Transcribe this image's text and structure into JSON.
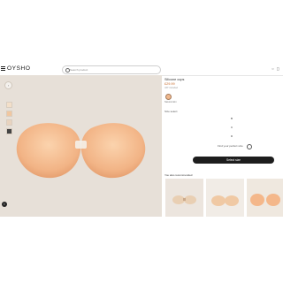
{
  "header": {
    "brand": "OYSHO",
    "search_placeholder": "Search product",
    "icons": [
      "user-icon",
      "heart-icon",
      "bag-icon"
    ]
  },
  "gallery": {
    "back_label": "‹",
    "info_label": "i"
  },
  "product": {
    "title": "Silicone cups",
    "price": "£29.99",
    "vat": "VAT included",
    "color_label": "Natural skin",
    "swatch_color": "#f0b88d",
    "size_heading": "Size select",
    "sizes": [
      "B",
      "C",
      "D"
    ],
    "size_guide": "Find your perfect size",
    "select_button": "Select size"
  },
  "recommendations": {
    "title": "You also recommended"
  }
}
